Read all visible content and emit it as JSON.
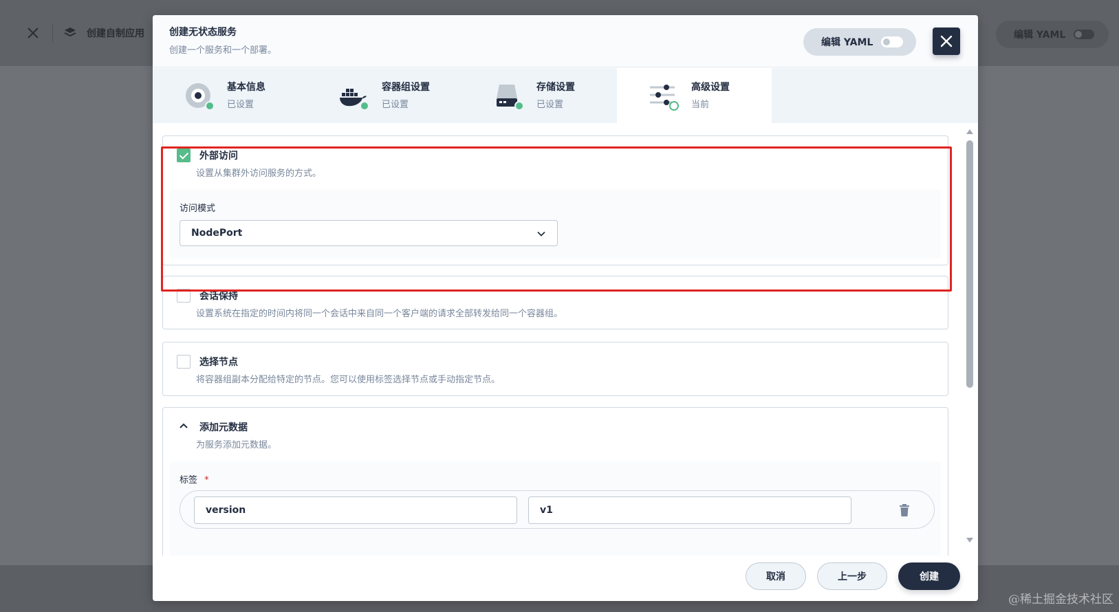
{
  "background": {
    "app_title": "创建自制应用",
    "yaml_label": "编辑 YAML"
  },
  "modal": {
    "title": "创建无状态服务",
    "description": "创建一个服务和一个部署。",
    "yaml_toggle_label": "编辑 YAML",
    "close_icon": "close-icon"
  },
  "steps": [
    {
      "name": "基本信息",
      "status": "已设置",
      "icon": "basic-info-icon"
    },
    {
      "name": "容器组设置",
      "status": "已设置",
      "icon": "docker-icon"
    },
    {
      "name": "存储设置",
      "status": "已设置",
      "icon": "storage-icon"
    },
    {
      "name": "高级设置",
      "status": "当前",
      "icon": "sliders-icon"
    }
  ],
  "sections": {
    "external_access": {
      "title": "外部访问",
      "description": "设置从集群外访问服务的方式。",
      "checked": true,
      "mode_label": "访问模式",
      "mode_value": "NodePort"
    },
    "session_affinity": {
      "title": "会话保持",
      "description": "设置系统在指定的时间内将同一个会话中来自同一个客户端的请求全部转发给同一个容器组。",
      "checked": false
    },
    "node_selector": {
      "title": "选择节点",
      "description": "将容器组副本分配给特定的节点。您可以使用标签选择节点或手动指定节点。",
      "checked": false
    },
    "metadata": {
      "title": "添加元数据",
      "description": "为服务添加元数据。",
      "labels_label": "标签",
      "required_mark": "*",
      "label_key": "version",
      "label_value": "v1"
    }
  },
  "footer": {
    "cancel": "取消",
    "previous": "上一步",
    "create": "创建"
  },
  "watermark": "@稀土掘金技术社区",
  "colors": {
    "accent_green": "#55bc8a",
    "dark_button": "#242e42",
    "highlight_red": "#e0231f"
  }
}
